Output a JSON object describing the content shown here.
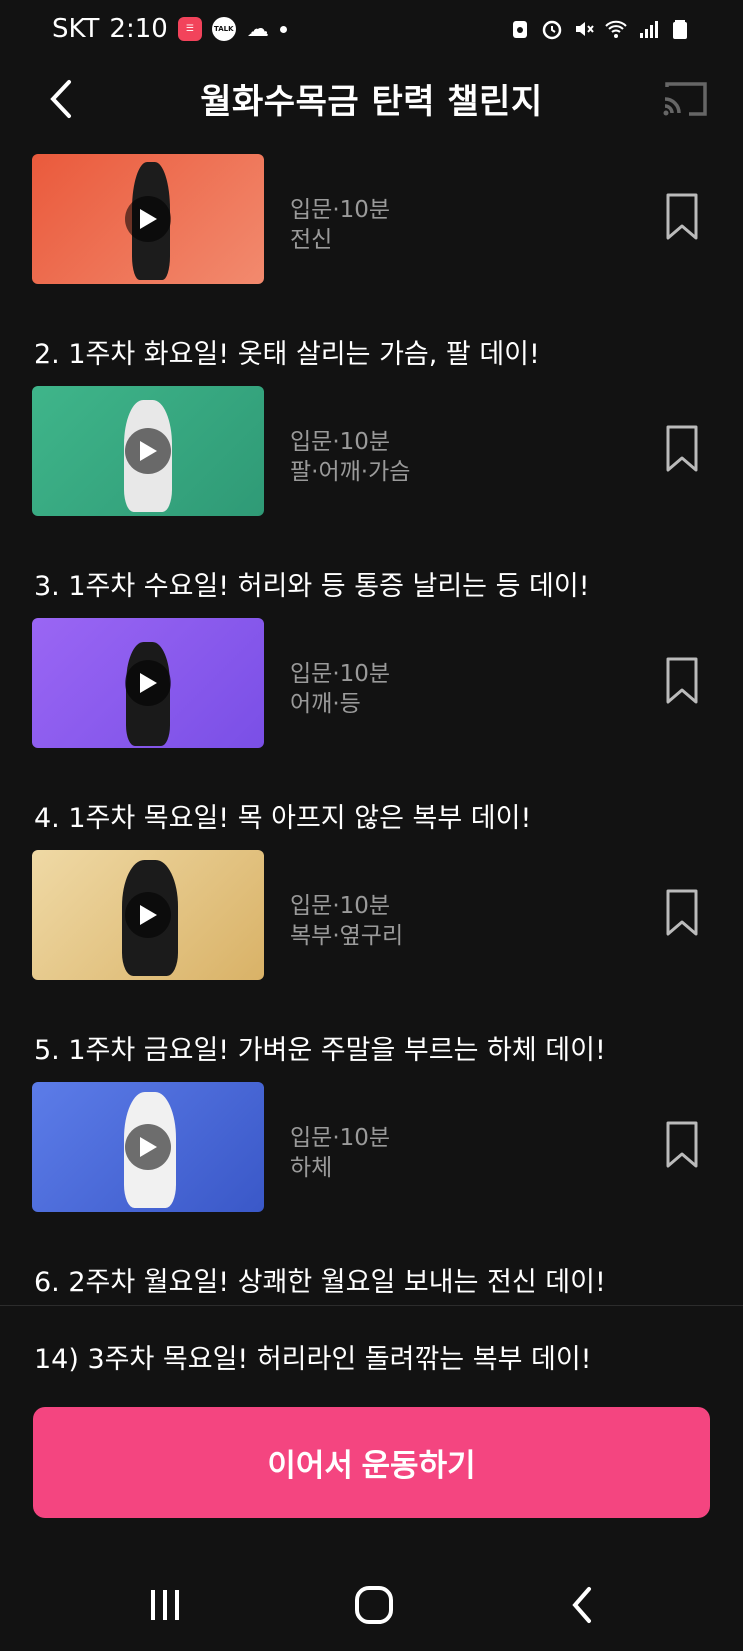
{
  "status_bar": {
    "carrier": "SKT",
    "time": "2:10",
    "talk_badge": "TALK",
    "icons": [
      "app-red-icon",
      "kakaotalk-icon",
      "cloud-icon",
      "dot-icon",
      "recycle-icon",
      "alarm-icon",
      "mute-icon",
      "wifi-icon",
      "signal-icon",
      "battery-icon"
    ]
  },
  "header": {
    "title": "월화수목금 탄력 챌린지",
    "back_icon": "back-chevron-icon",
    "cast_icon": "cast-icon"
  },
  "items": [
    {
      "title": "",
      "level": "입문",
      "duration": "10분",
      "body": "전신",
      "thumb_color": "#e9684a"
    },
    {
      "title": "2. 1주차 화요일! 옷태 살리는 가슴, 팔 데이!",
      "level": "입문",
      "duration": "10분",
      "body": "팔·어깨·가슴",
      "thumb_color": "#3faf84"
    },
    {
      "title": "3. 1주차 수요일! 허리와 등 통증 날리는 등 데이!",
      "level": "입문",
      "duration": "10분",
      "body": "어깨·등",
      "thumb_color": "#8a5cf0"
    },
    {
      "title": "4. 1주차 목요일! 목 아프지 않은 복부 데이!",
      "level": "입문",
      "duration": "10분",
      "body": "복부·옆구리",
      "thumb_color": "#e2c07a"
    },
    {
      "title": "5. 1주차 금요일! 가벼운 주말을 부르는 하체 데이!",
      "level": "입문",
      "duration": "10분",
      "body": "하체",
      "thumb_color": "#4a69d6"
    },
    {
      "title": "6. 2주차 월요일! 상쾌한 월요일 보내는 전신 데이!"
    }
  ],
  "current_workout": "14) 3주차 목요일! 허리라인 돌려깎는 복부 데이!",
  "continue_button": "이어서 운동하기",
  "nav": {
    "recents": "recents-icon",
    "home": "home-icon",
    "back": "back-icon"
  },
  "colors": {
    "accent": "#f44580",
    "background": "#121212",
    "meta_text": "#9a9a9a"
  }
}
